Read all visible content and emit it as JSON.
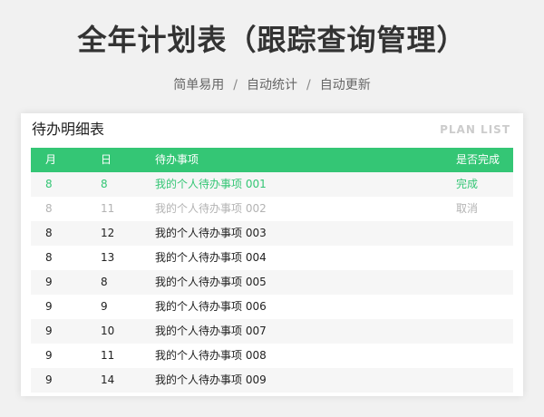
{
  "header": {
    "title": "全年计划表（跟踪查询管理）",
    "features": [
      "简单易用",
      "自动统计",
      "自动更新"
    ],
    "separator": "/"
  },
  "panel": {
    "title": "待办明细表",
    "tag": "PLAN LIST"
  },
  "table": {
    "columns": {
      "month": "月",
      "day": "日",
      "task": "待办事项",
      "status": "是否完成"
    },
    "rows": [
      {
        "month": "8",
        "day": "8",
        "task": "我的个人待办事项 001",
        "status": "完成",
        "state": "done"
      },
      {
        "month": "8",
        "day": "11",
        "task": "我的个人待办事项 002",
        "status": "取消",
        "state": "cancelled"
      },
      {
        "month": "8",
        "day": "12",
        "task": "我的个人待办事项 003",
        "status": "",
        "state": "open"
      },
      {
        "month": "8",
        "day": "13",
        "task": "我的个人待办事项 004",
        "status": "",
        "state": "open"
      },
      {
        "month": "9",
        "day": "8",
        "task": "我的个人待办事项 005",
        "status": "",
        "state": "open"
      },
      {
        "month": "9",
        "day": "9",
        "task": "我的个人待办事项 006",
        "status": "",
        "state": "open"
      },
      {
        "month": "9",
        "day": "10",
        "task": "我的个人待办事项 007",
        "status": "",
        "state": "open"
      },
      {
        "month": "9",
        "day": "11",
        "task": "我的个人待办事项 008",
        "status": "",
        "state": "open"
      },
      {
        "month": "9",
        "day": "14",
        "task": "我的个人待办事项 009",
        "status": "",
        "state": "open"
      }
    ]
  },
  "colors": {
    "accent": "#34c675",
    "cancelled": "#b3b3b3",
    "background": "#f1f1f1"
  }
}
